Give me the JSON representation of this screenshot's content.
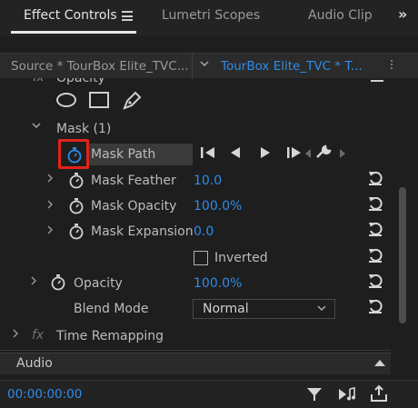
{
  "tabs": [
    {
      "label": "Effect Controls",
      "active": true
    },
    {
      "label": "Lumetri Scopes",
      "active": false
    },
    {
      "label": "Audio Clip",
      "active": false
    }
  ],
  "overflow_label": "»",
  "source": {
    "left_label": "Source * TourBox Elite_TVC...",
    "right_label": "TourBox Elite_TVC * T..."
  },
  "effects": {
    "opacity_header": "Opacity",
    "mask": {
      "label": "Mask (1)",
      "mask_path_label": "Mask Path",
      "feather_label": "Mask Feather",
      "feather_value": "10.0",
      "opacity_label": "Mask Opacity",
      "opacity_value": "100.0",
      "opacity_unit": "%",
      "expansion_label": "Mask Expansion",
      "expansion_value": "0.0",
      "inverted_label": "Inverted"
    },
    "opacity_label": "Opacity",
    "opacity_value": "100.0",
    "opacity_unit": "%",
    "blend_mode_label": "Blend Mode",
    "blend_mode_value": "Normal",
    "time_remapping_label": "Time Remapping",
    "fx_label": "fx"
  },
  "audio_label": "Audio",
  "timecode": "00:00:00:00",
  "colors": {
    "accent_blue": "#2d8ceb",
    "highlight_red": "#e2231a",
    "background": "#1e1e1e"
  }
}
